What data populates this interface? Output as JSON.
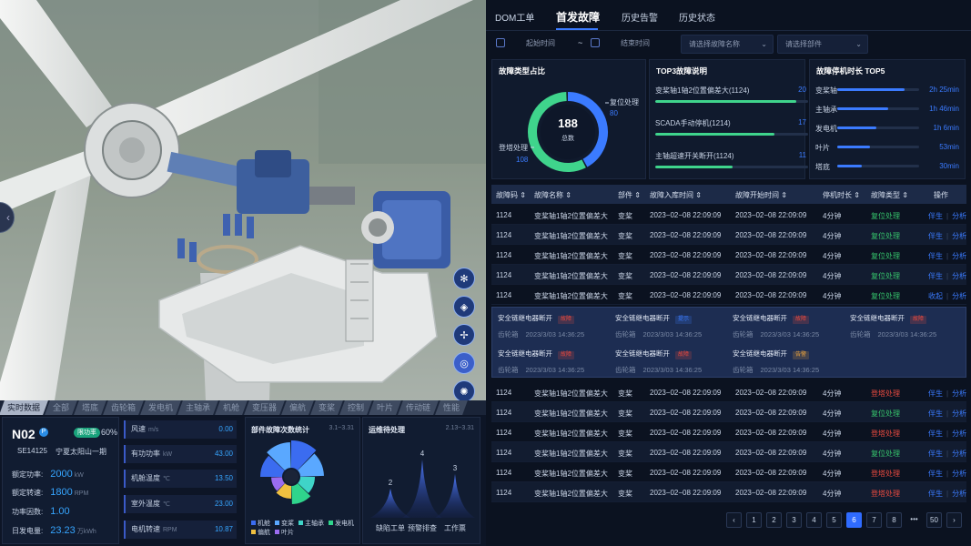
{
  "comp_tabs": [
    "实时数据",
    "全部",
    "塔底",
    "齿轮箱",
    "发电机",
    "主轴承",
    "机舱",
    "变压器",
    "偏航",
    "变桨",
    "控制",
    "叶片",
    "传动链",
    "性能"
  ],
  "device": {
    "id": "N02",
    "badge": "P",
    "status": "限功率",
    "status_pct": "60%",
    "model": "SE14125",
    "site": "宁夏太阳山一期",
    "kpis": [
      {
        "label": "额定功率:",
        "value": "2000",
        "unit": "kW"
      },
      {
        "label": "额定转速:",
        "value": "1800",
        "unit": "RPM"
      },
      {
        "label": "功率因数:",
        "value": "1.00",
        "unit": ""
      },
      {
        "label": "日发电量:",
        "value": "23.23",
        "unit": "万kWh"
      }
    ]
  },
  "metrics": [
    {
      "label": "风速",
      "unit": "m/s",
      "value": "0.00"
    },
    {
      "label": "有功功率",
      "unit": "kW",
      "value": "43.00"
    },
    {
      "label": "机舱温度",
      "unit": "℃",
      "value": "13.50"
    },
    {
      "label": "室外温度",
      "unit": "℃",
      "value": "23.00"
    },
    {
      "label": "电机转速",
      "unit": "RPM",
      "value": "10.87"
    }
  ],
  "fault_count_chart": {
    "title": "部件故障次数统计",
    "date": "3.1~3.31",
    "legend": [
      "机舱",
      "变桨",
      "主轴承",
      "发电机",
      "偏航",
      "叶片"
    ],
    "colors": [
      "#3b6cf0",
      "#5aa8ff",
      "#3fd4c8",
      "#2fd48c",
      "#f0c040",
      "#9a6cf0"
    ]
  },
  "ops_chart": {
    "title": "运维待处理",
    "date": "2.13~3.31",
    "labels": [
      "缺陷工单",
      "预警排查",
      "工作票"
    ],
    "values": [
      2,
      4,
      3
    ]
  },
  "right_tabs": [
    "DOM工单",
    "首发故障",
    "历史告警",
    "历史状态"
  ],
  "filters": {
    "start": "起始时间",
    "tilde": "~",
    "end": "结束时间",
    "fault_name_placeholder": "请选择故障名称",
    "part_placeholder": "请选择部件"
  },
  "fault_type": {
    "title": "故障类型占比",
    "total": "188",
    "total_label": "总数",
    "slices": [
      {
        "name": "复位处理",
        "value": 80,
        "color": "#3b7bff"
      },
      {
        "name": "登塔处理",
        "value": 108,
        "color": "#3fd48c"
      }
    ]
  },
  "top3": {
    "title": "TOP3故障说明",
    "items": [
      {
        "name": "变桨轴1轴2位置偏差大(1124)",
        "value": 20
      },
      {
        "name": "SCADA手动停机(1214)",
        "value": 17
      },
      {
        "name": "主轴超速开关断开(1124)",
        "value": 11
      }
    ]
  },
  "downtime": {
    "title": "故障停机时长 TOP5",
    "items": [
      {
        "name": "变桨轴",
        "value": "2h 25min",
        "ratio": 0.82
      },
      {
        "name": "主轴承",
        "value": "1h 46min",
        "ratio": 0.62
      },
      {
        "name": "发电机",
        "value": "1h 6min",
        "ratio": 0.48
      },
      {
        "name": "叶片",
        "value": "53min",
        "ratio": 0.4
      },
      {
        "name": "塔底",
        "value": "30min",
        "ratio": 0.3
      }
    ]
  },
  "table": {
    "headers": [
      "故障码 ⇕",
      "故障名称 ⇕",
      "部件 ⇕",
      "故障入库时间 ⇕",
      "故障开始时间 ⇕",
      "停机时长 ⇕",
      "故障类型 ⇕",
      "操作"
    ],
    "rows_top": [
      {
        "code": "1124",
        "name": "变桨轴1轴2位置偏差大",
        "part": "变桨",
        "in": "2023−02−08 22:09:09",
        "start": "2023−02−08 22:09:09",
        "dur": "4分钟",
        "type": "复位处理",
        "op1": "伴生",
        "op2": "分析"
      },
      {
        "code": "1124",
        "name": "变桨轴1轴2位置偏差大",
        "part": "变桨",
        "in": "2023−02−08 22:09:09",
        "start": "2023−02−08 22:09:09",
        "dur": "4分钟",
        "type": "复位处理",
        "op1": "伴生",
        "op2": "分析"
      },
      {
        "code": "1124",
        "name": "变桨轴1轴2位置偏差大",
        "part": "变桨",
        "in": "2023−02−08 22:09:09",
        "start": "2023−02−08 22:09:09",
        "dur": "4分钟",
        "type": "复位处理",
        "op1": "伴生",
        "op2": "分析"
      },
      {
        "code": "1124",
        "name": "变桨轴1轴2位置偏差大",
        "part": "变桨",
        "in": "2023−02−08 22:09:09",
        "start": "2023−02−08 22:09:09",
        "dur": "4分钟",
        "type": "复位处理",
        "op1": "伴生",
        "op2": "分析"
      },
      {
        "code": "1124",
        "name": "变桨轴1轴2位置偏差大",
        "part": "变桨",
        "in": "2023−02−08 22:09:09",
        "start": "2023−02−08 22:09:09",
        "dur": "4分钟",
        "type": "复位处理",
        "op1": "收起",
        "op2": "分析"
      }
    ],
    "rows_bottom": [
      {
        "code": "1124",
        "name": "变桨轴1轴2位置偏差大",
        "part": "变桨",
        "in": "2023−02−08 22:09:09",
        "start": "2023−02−08 22:09:09",
        "dur": "4分钟",
        "type": "登塔处理",
        "op1": "伴生",
        "op2": "分析"
      },
      {
        "code": "1124",
        "name": "变桨轴1轴2位置偏差大",
        "part": "变桨",
        "in": "2023−02−08 22:09:09",
        "start": "2023−02−08 22:09:09",
        "dur": "4分钟",
        "type": "复位处理",
        "op1": "伴生",
        "op2": "分析"
      },
      {
        "code": "1124",
        "name": "变桨轴1轴2位置偏差大",
        "part": "变桨",
        "in": "2023−02−08 22:09:09",
        "start": "2023−02−08 22:09:09",
        "dur": "4分钟",
        "type": "登塔处理",
        "op1": "伴生",
        "op2": "分析"
      },
      {
        "code": "1124",
        "name": "变桨轴1轴2位置偏差大",
        "part": "变桨",
        "in": "2023−02−08 22:09:09",
        "start": "2023−02−08 22:09:09",
        "dur": "4分钟",
        "type": "复位处理",
        "op1": "伴生",
        "op2": "分析"
      },
      {
        "code": "1124",
        "name": "变桨轴1轴2位置偏差大",
        "part": "变桨",
        "in": "2023−02−08 22:09:09",
        "start": "2023−02−08 22:09:09",
        "dur": "4分钟",
        "type": "登塔处理",
        "op1": "伴生",
        "op2": "分析"
      },
      {
        "code": "1124",
        "name": "变桨轴1轴2位置偏差大",
        "part": "变桨",
        "in": "2023−02−08 22:09:09",
        "start": "2023−02−08 22:09:09",
        "dur": "4分钟",
        "type": "登塔处理",
        "op1": "伴生",
        "op2": "分析"
      }
    ],
    "detail_cards": [
      {
        "title": "安全链继电器断开",
        "tag": "故障",
        "tag_color": "#e84a3f",
        "part": "齿轮箱",
        "time": "2023/3/03 14:36:25"
      },
      {
        "title": "安全链继电器断开",
        "tag": "提示",
        "tag_color": "#3b7bff",
        "part": "齿轮箱",
        "time": "2023/3/03 14:36:25"
      },
      {
        "title": "安全链继电器断开",
        "tag": "故障",
        "tag_color": "#e84a3f",
        "part": "齿轮箱",
        "time": "2023/3/03 14:36:25"
      },
      {
        "title": "安全链继电器断开",
        "tag": "故障",
        "tag_color": "#e84a3f",
        "part": "齿轮箱",
        "time": "2023/3/03 14:36:25"
      },
      {
        "title": "安全链继电器断开",
        "tag": "故障",
        "tag_color": "#e84a3f",
        "part": "齿轮箱",
        "time": "2023/3/03 14:36:25"
      },
      {
        "title": "安全链继电器断开",
        "tag": "故障",
        "tag_color": "#e84a3f",
        "part": "齿轮箱",
        "time": "2023/3/03 14:36:25"
      },
      {
        "title": "安全链继电器断开",
        "tag": "告警",
        "tag_color": "#e8a23f",
        "part": "齿轮箱",
        "time": "2023/3/03 14:36:25"
      }
    ]
  },
  "pagination": {
    "prev": "‹",
    "pages": [
      "1",
      "2",
      "3",
      "4",
      "5",
      "6",
      "7",
      "8",
      "•••",
      "50"
    ],
    "current": "6",
    "next": "›"
  }
}
